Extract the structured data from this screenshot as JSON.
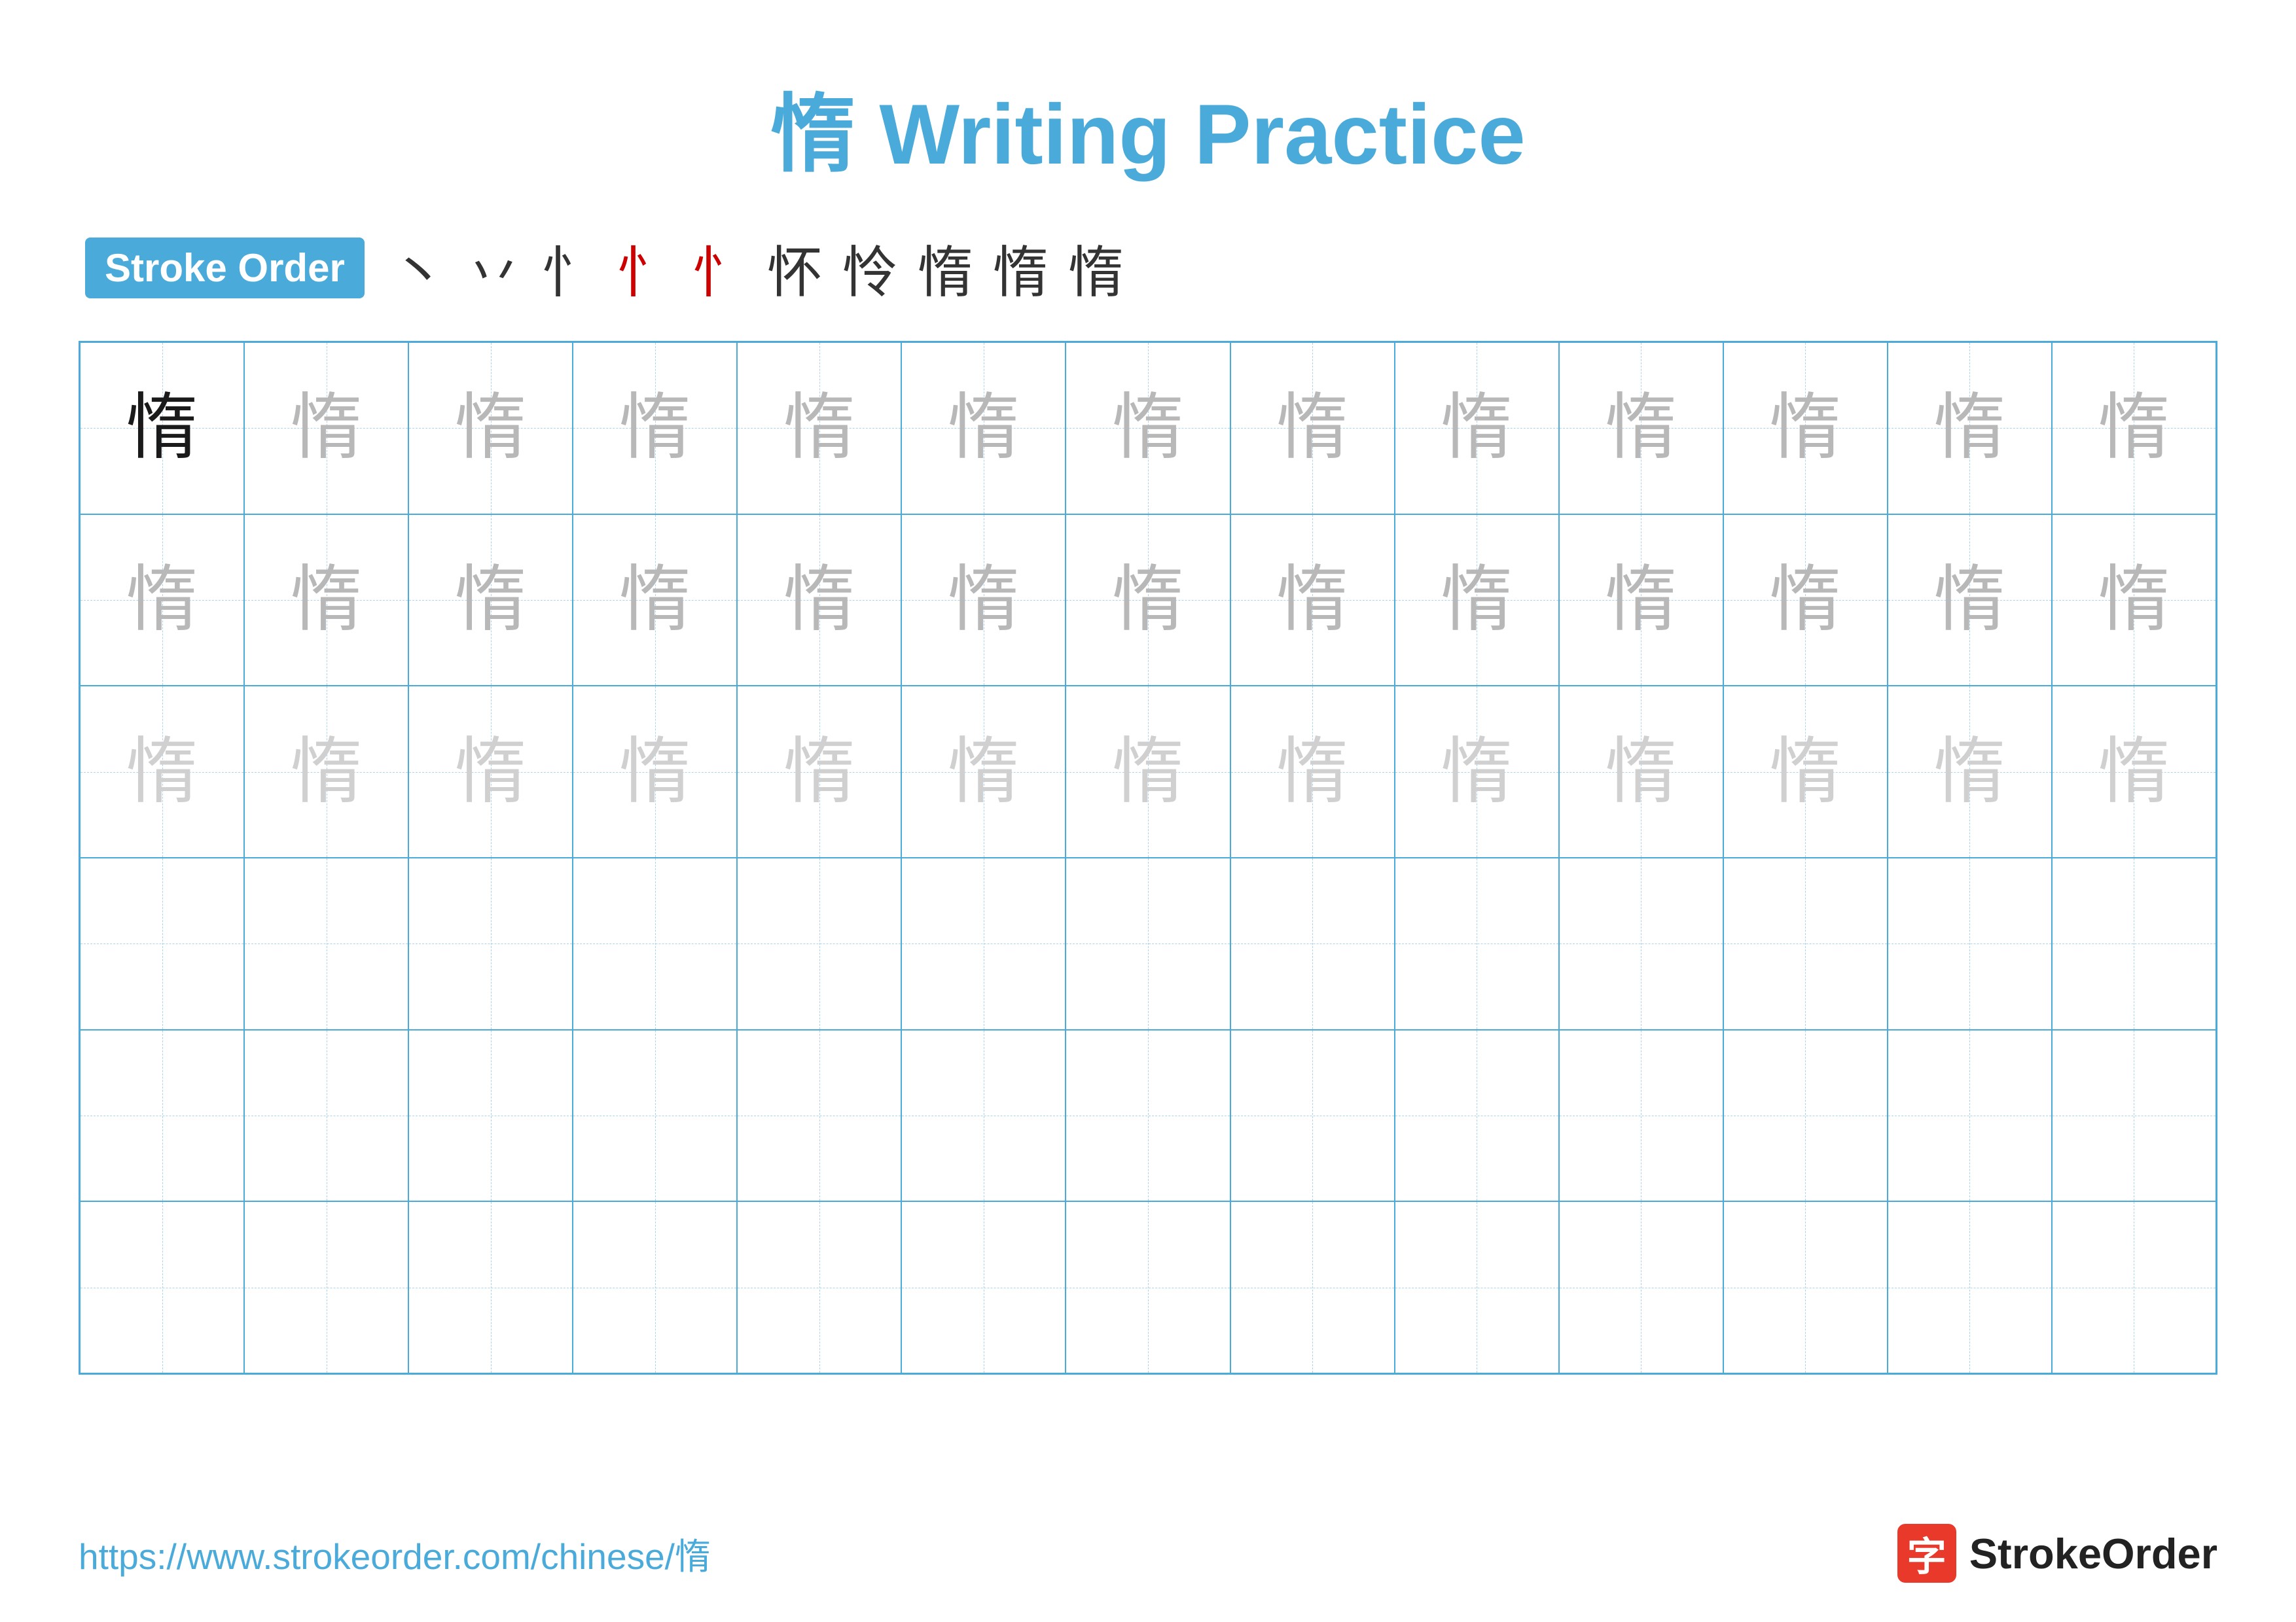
{
  "title": "惰 Writing Practice",
  "stroke_order": {
    "badge_label": "Stroke Order",
    "strokes": [
      "丶",
      "八",
      "忄",
      "忄'",
      "忄\"",
      "忄ˊ",
      "忄ˊˊ",
      "惰",
      "惰",
      "惰"
    ]
  },
  "character": "惰",
  "grid": {
    "rows": 6,
    "cols": 13,
    "cells": [
      {
        "row": 0,
        "col": 0,
        "shade": "dark"
      },
      {
        "row": 0,
        "col": 1,
        "shade": "medium-gray"
      },
      {
        "row": 0,
        "col": 2,
        "shade": "medium-gray"
      },
      {
        "row": 0,
        "col": 3,
        "shade": "medium-gray"
      },
      {
        "row": 0,
        "col": 4,
        "shade": "medium-gray"
      },
      {
        "row": 0,
        "col": 5,
        "shade": "medium-gray"
      },
      {
        "row": 0,
        "col": 6,
        "shade": "medium-gray"
      },
      {
        "row": 0,
        "col": 7,
        "shade": "medium-gray"
      },
      {
        "row": 0,
        "col": 8,
        "shade": "medium-gray"
      },
      {
        "row": 0,
        "col": 9,
        "shade": "medium-gray"
      },
      {
        "row": 0,
        "col": 10,
        "shade": "medium-gray"
      },
      {
        "row": 0,
        "col": 11,
        "shade": "medium-gray"
      },
      {
        "row": 0,
        "col": 12,
        "shade": "medium-gray"
      },
      {
        "row": 1,
        "col": 0,
        "shade": "medium-gray"
      },
      {
        "row": 1,
        "col": 1,
        "shade": "medium-gray"
      },
      {
        "row": 1,
        "col": 2,
        "shade": "medium-gray"
      },
      {
        "row": 1,
        "col": 3,
        "shade": "medium-gray"
      },
      {
        "row": 1,
        "col": 4,
        "shade": "medium-gray"
      },
      {
        "row": 1,
        "col": 5,
        "shade": "medium-gray"
      },
      {
        "row": 1,
        "col": 6,
        "shade": "medium-gray"
      },
      {
        "row": 1,
        "col": 7,
        "shade": "medium-gray"
      },
      {
        "row": 1,
        "col": 8,
        "shade": "medium-gray"
      },
      {
        "row": 1,
        "col": 9,
        "shade": "medium-gray"
      },
      {
        "row": 1,
        "col": 10,
        "shade": "medium-gray"
      },
      {
        "row": 1,
        "col": 11,
        "shade": "medium-gray"
      },
      {
        "row": 1,
        "col": 12,
        "shade": "medium-gray"
      },
      {
        "row": 2,
        "col": 0,
        "shade": "light-gray"
      },
      {
        "row": 2,
        "col": 1,
        "shade": "light-gray"
      },
      {
        "row": 2,
        "col": 2,
        "shade": "light-gray"
      },
      {
        "row": 2,
        "col": 3,
        "shade": "light-gray"
      },
      {
        "row": 2,
        "col": 4,
        "shade": "light-gray"
      },
      {
        "row": 2,
        "col": 5,
        "shade": "light-gray"
      },
      {
        "row": 2,
        "col": 6,
        "shade": "light-gray"
      },
      {
        "row": 2,
        "col": 7,
        "shade": "light-gray"
      },
      {
        "row": 2,
        "col": 8,
        "shade": "light-gray"
      },
      {
        "row": 2,
        "col": 9,
        "shade": "light-gray"
      },
      {
        "row": 2,
        "col": 10,
        "shade": "light-gray"
      },
      {
        "row": 2,
        "col": 11,
        "shade": "light-gray"
      },
      {
        "row": 2,
        "col": 12,
        "shade": "light-gray"
      }
    ]
  },
  "footer": {
    "url": "https://www.strokeorder.com/chinese/惰",
    "logo_text": "StrokeOrder",
    "logo_char": "字"
  },
  "colors": {
    "accent": "#4aabdb",
    "badge_bg": "#4aabdb",
    "red": "#cc0000",
    "dark_text": "#1a1a1a",
    "logo_bg": "#e8392a"
  }
}
